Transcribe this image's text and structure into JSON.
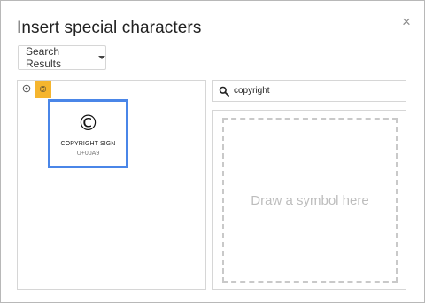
{
  "dialog": {
    "title": "Insert special characters",
    "close_label": "×"
  },
  "category_dropdown": {
    "selected": "Search Results"
  },
  "recent": {
    "reset_icon": "reset-icon",
    "tile_char": "©"
  },
  "results": [
    {
      "char": "©",
      "name": "COPYRIGHT SIGN",
      "code": "U+00A9"
    }
  ],
  "search": {
    "value": "copyright",
    "icon": "search-icon"
  },
  "draw": {
    "placeholder": "Draw a symbol here"
  },
  "colors": {
    "selected_border": "#4a86e8",
    "recent_tile": "#f5b52e"
  }
}
